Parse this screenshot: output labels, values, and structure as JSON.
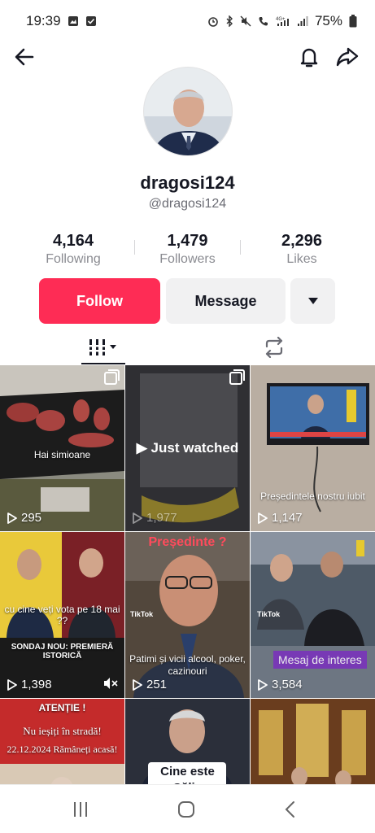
{
  "status_bar": {
    "time": "19:39",
    "battery": "75%",
    "icons": [
      "gallery-icon",
      "check-icon",
      "alarm-icon",
      "bluetooth-icon",
      "mute-icon",
      "wifi-call-icon",
      "4g-signal-icon",
      "signal-icon",
      "battery-icon"
    ]
  },
  "nav": {
    "back_icon": "arrow-left-icon",
    "bell_icon": "bell-icon",
    "share_icon": "share-icon"
  },
  "profile": {
    "username": "dragosi124",
    "handle": "@dragosi124"
  },
  "stats": {
    "following": {
      "value": "4,164",
      "label": "Following"
    },
    "followers": {
      "value": "1,479",
      "label": "Followers"
    },
    "likes": {
      "value": "2,296",
      "label": "Likes"
    }
  },
  "actions": {
    "follow_label": "Follow",
    "message_label": "Message"
  },
  "tabs": {
    "videos_icon": "grid-videos-icon",
    "reposts_icon": "repost-icon"
  },
  "videos": [
    {
      "views": "295",
      "caption": "Hai simioane"
    },
    {
      "views": "1,977",
      "overlay": "Just watched"
    },
    {
      "views": "1,147",
      "caption": "Președintele  nostru iubit"
    },
    {
      "views": "1,398",
      "caption": "cu cine veți vota pe 18 mai ??",
      "banner": "SONDAJ NOU: PREMIERĂ ISTORICĂ"
    },
    {
      "views": "251",
      "top_text": "Președinte ?",
      "caption": "Patimi și vicii alcool, poker, cazinouri"
    },
    {
      "views": "3,584",
      "badge": "Mesaj de interes"
    },
    {
      "title": "ATENȚIE !",
      "line1": "Nu ieșiți în stradă!",
      "line2": "22.12.2024 Rămâneți acasă!"
    },
    {
      "caption": "Cine este Călin Georgescu?"
    },
    {}
  ],
  "bottom_nav": {
    "recent_icon": "recent-apps-icon",
    "home_icon": "home-icon",
    "back_icon": "back-chevron-icon"
  },
  "colors": {
    "follow": "#fe2c55",
    "secondary_button": "#f1f1f2",
    "text_primary": "#161823",
    "text_secondary": "#8a8b91",
    "badge": "#7b2fbe"
  }
}
